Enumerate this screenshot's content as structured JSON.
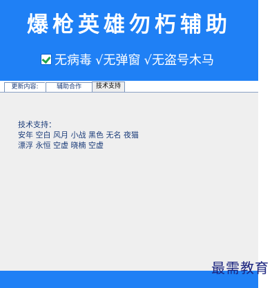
{
  "header": {
    "title": "爆枪英雄勿朽辅助",
    "features": [
      "无病毒",
      "√无弹窗",
      "√无盗号木马"
    ]
  },
  "tabs": [
    {
      "label": "更新内容:",
      "active": false
    },
    {
      "label": "辅助合作",
      "active": false
    },
    {
      "label": "技术支持",
      "active": true
    }
  ],
  "content": {
    "heading": "技术支持：",
    "lines": [
      "安年 空白 风月 小战 黑色 无名 夜猫",
      "漂浮 永恒 空虚 晓楠 空虚"
    ]
  },
  "watermark": "最需教育",
  "colors": {
    "header_blue": "#1f80f5",
    "panel_bg": "#efefef",
    "text_blue": "#1c3d7a"
  }
}
